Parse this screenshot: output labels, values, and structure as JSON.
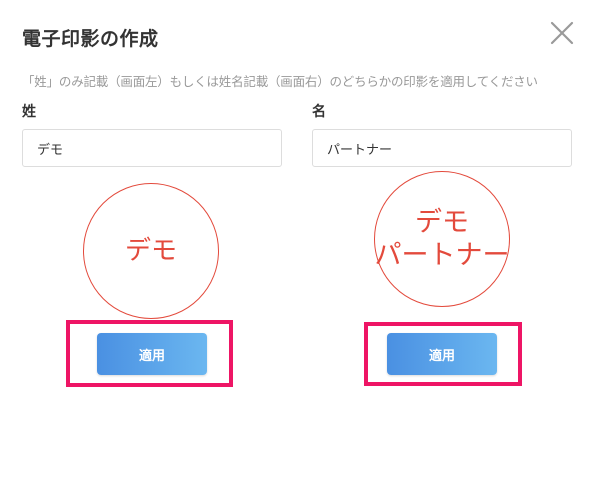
{
  "dialog": {
    "title": "電子印影の作成",
    "instruction": "「姓」のみ記載（画面左）もしくは姓名記載（画面右）のどちらかの印影を適用してください",
    "close_icon": "close-icon"
  },
  "fields": {
    "sei": {
      "label": "姓",
      "value": "デモ"
    },
    "mei": {
      "label": "名",
      "value": "パートナー"
    }
  },
  "seals": {
    "left": {
      "line1": "デモ"
    },
    "right": {
      "line1": "デモ",
      "line2": "パートナー"
    }
  },
  "buttons": {
    "apply_left": "適用",
    "apply_right": "適用"
  },
  "colors": {
    "seal_red": "#e34a3c",
    "highlight_pink": "#ee1565",
    "button_blue_start": "#4a90e2",
    "button_blue_end": "#6bb7f0"
  }
}
